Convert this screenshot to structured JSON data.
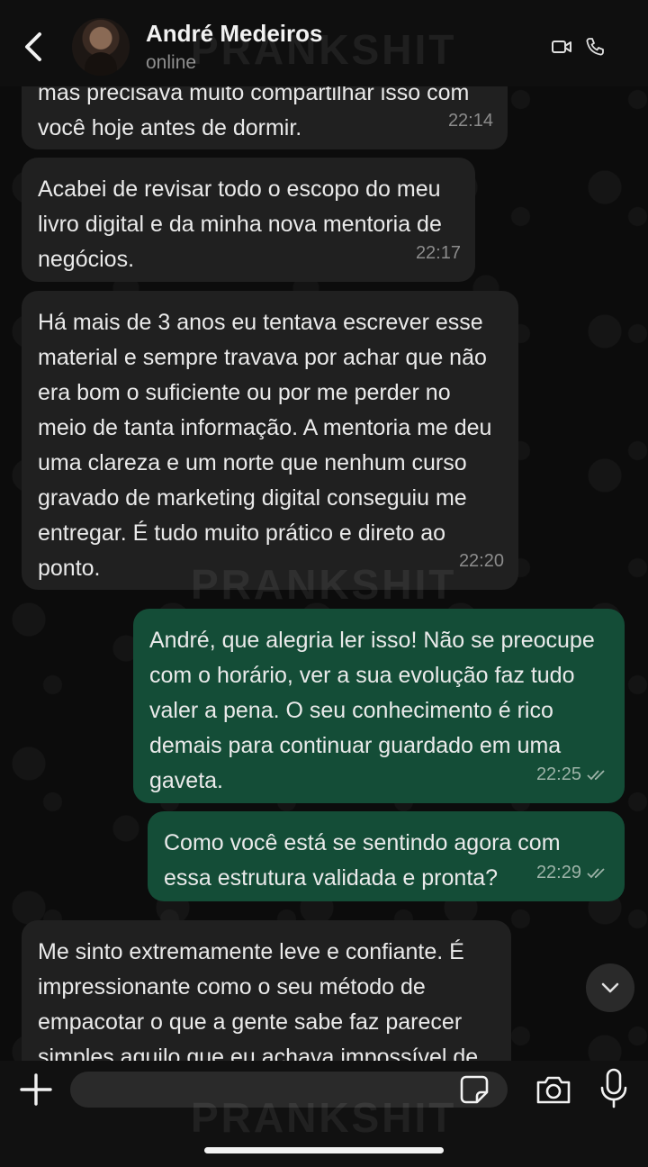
{
  "header": {
    "contact_name": "André Medeiros",
    "status": "online"
  },
  "watermark": "PRANKSHIT",
  "messages": [
    {
      "direction": "in",
      "text": "mas precisava muito compartilhar isso com você hoje antes de dormir.",
      "time": "22:14"
    },
    {
      "direction": "in",
      "text": "Acabei de revisar todo o escopo do meu livro digital e da minha nova mentoria de negócios.",
      "time": "22:17"
    },
    {
      "direction": "in",
      "text": "Há mais de 3 anos eu tentava escrever esse material e sempre travava por achar que não era bom o suficiente ou por me perder no meio de tanta informação. A mentoria me deu uma clareza e um norte que nenhum curso gravado de marketing digital conseguiu me entregar. É tudo muito prático e direto ao ponto.",
      "time": "22:20"
    },
    {
      "direction": "out",
      "text": "André, que alegria ler isso! Não se preocupe com o horário, ver a sua evolução faz tudo valer a pena. O seu conhecimento é rico demais para continuar guardado em uma gaveta.",
      "time": "22:25"
    },
    {
      "direction": "out",
      "text": "Como você está se sentindo agora com essa estrutura validada e pronta?",
      "time": "22:29"
    },
    {
      "direction": "in",
      "text": "Me sinto extremamente leve e confiante. É impressionante como o seu método de empacotar o que a gente sabe faz parecer simples aquilo que eu achava impossível de",
      "time": ""
    }
  ],
  "input": {
    "value": "",
    "placeholder": ""
  },
  "colors": {
    "incoming_bubble": "#202020",
    "outgoing_bubble": "#144d37",
    "background": "#0c0c0c"
  }
}
